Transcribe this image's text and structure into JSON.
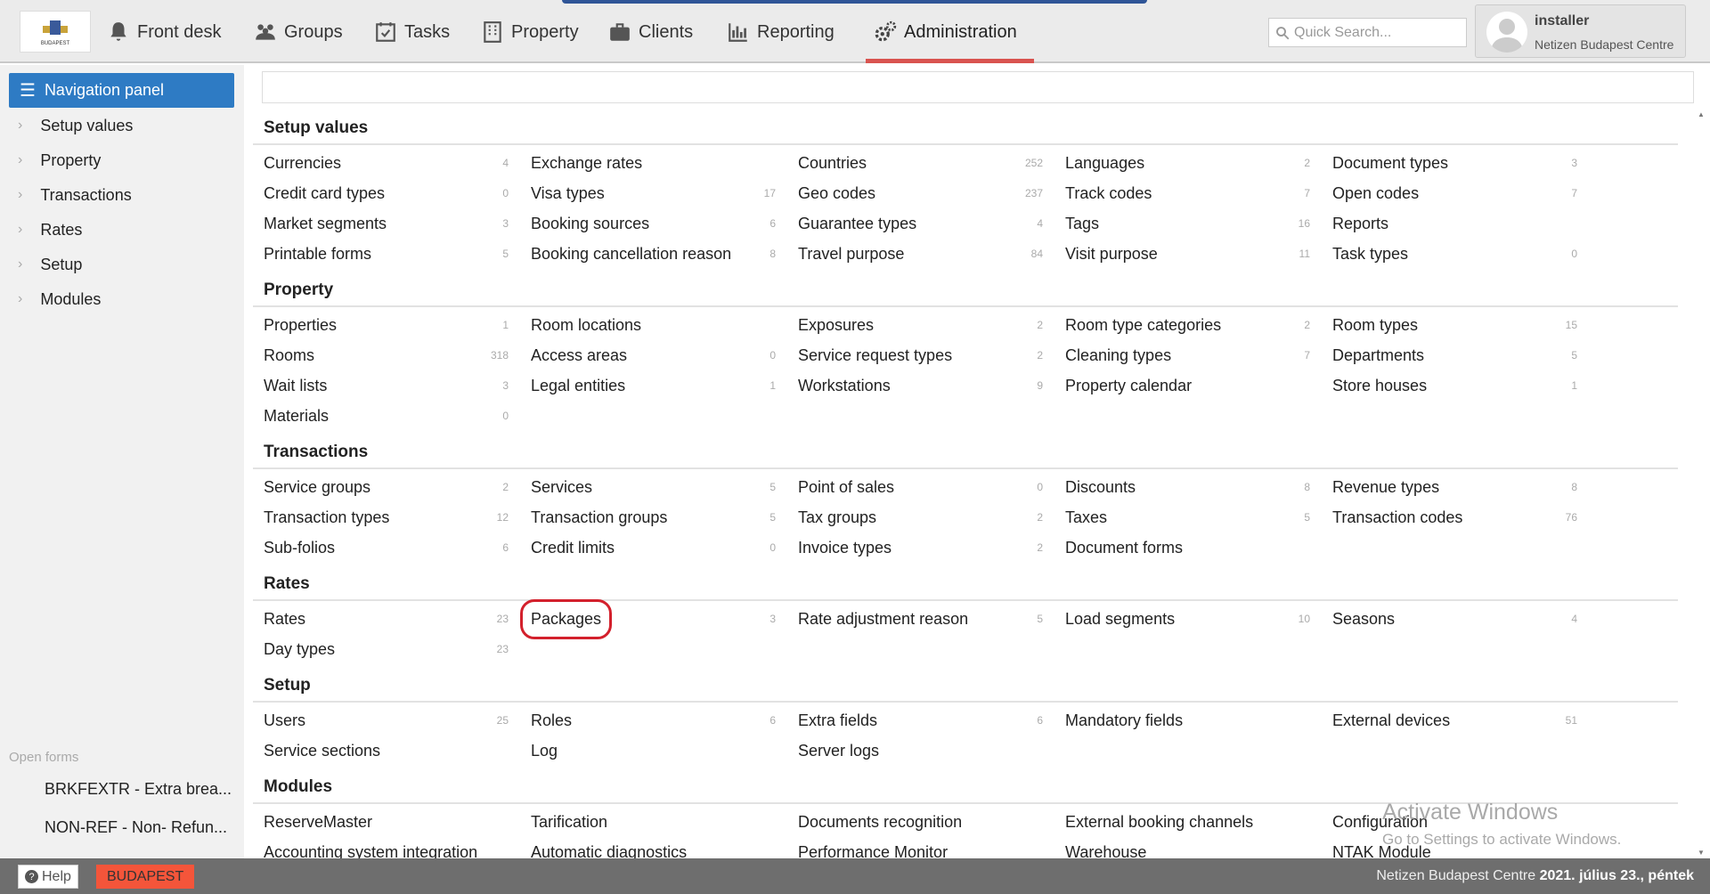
{
  "nav": {
    "tabs": [
      {
        "label": "Front desk",
        "icon": "bell-icon"
      },
      {
        "label": "Groups",
        "icon": "users-icon"
      },
      {
        "label": "Tasks",
        "icon": "calendar-check-icon"
      },
      {
        "label": "Property",
        "icon": "building-icon"
      },
      {
        "label": "Clients",
        "icon": "briefcase-icon"
      },
      {
        "label": "Reporting",
        "icon": "bar-chart-icon"
      },
      {
        "label": "Administration",
        "icon": "gears-icon",
        "active": true
      }
    ],
    "search_placeholder": "Quick Search...",
    "user": {
      "name": "installer",
      "property": "Netizen Budapest Centre"
    },
    "logo_text": "BUDAPEST"
  },
  "sidebar": {
    "title": "Navigation panel",
    "items": [
      "Setup values",
      "Property",
      "Transactions",
      "Rates",
      "Setup",
      "Modules"
    ],
    "open_forms_label": "Open forms",
    "open_forms": [
      "BRKFEXTR - Extra brea...",
      "NON-REF - Non- Refun..."
    ]
  },
  "sections": [
    {
      "title": "Setup values",
      "items": [
        [
          "Currencies",
          "4"
        ],
        [
          "Exchange rates",
          ""
        ],
        [
          "Countries",
          "252"
        ],
        [
          "Languages",
          "2"
        ],
        [
          "Document types",
          "3"
        ],
        [
          "Credit card types",
          "0"
        ],
        [
          "Visa types",
          "17"
        ],
        [
          "Geo codes",
          "237"
        ],
        [
          "Track codes",
          "7"
        ],
        [
          "Open codes",
          "7"
        ],
        [
          "Market segments",
          "3"
        ],
        [
          "Booking sources",
          "6"
        ],
        [
          "Guarantee types",
          "4"
        ],
        [
          "Tags",
          "16"
        ],
        [
          "Reports",
          ""
        ],
        [
          "Printable forms",
          "5"
        ],
        [
          "Booking cancellation reason",
          "8"
        ],
        [
          "Travel purpose",
          "84"
        ],
        [
          "Visit purpose",
          "11"
        ],
        [
          "Task types",
          "0"
        ]
      ]
    },
    {
      "title": "Property",
      "items": [
        [
          "Properties",
          "1"
        ],
        [
          "Room locations",
          ""
        ],
        [
          "Exposures",
          "2"
        ],
        [
          "Room type categories",
          "2"
        ],
        [
          "Room types",
          "15"
        ],
        [
          "Rooms",
          "318"
        ],
        [
          "Access areas",
          "0"
        ],
        [
          "Service request types",
          "2"
        ],
        [
          "Cleaning types",
          "7"
        ],
        [
          "Departments",
          "5"
        ],
        [
          "Wait lists",
          "3"
        ],
        [
          "Legal entities",
          "1"
        ],
        [
          "Workstations",
          "9"
        ],
        [
          "Property calendar",
          ""
        ],
        [
          "Store houses",
          "1"
        ],
        [
          "Materials",
          "0"
        ]
      ]
    },
    {
      "title": "Transactions",
      "items": [
        [
          "Service groups",
          "2"
        ],
        [
          "Services",
          "5"
        ],
        [
          "Point of sales",
          "0"
        ],
        [
          "Discounts",
          "8"
        ],
        [
          "Revenue types",
          "8"
        ],
        [
          "Transaction types",
          "12"
        ],
        [
          "Transaction groups",
          "5"
        ],
        [
          "Tax groups",
          "2"
        ],
        [
          "Taxes",
          "5"
        ],
        [
          "Transaction codes",
          "76"
        ],
        [
          "Sub-folios",
          "6"
        ],
        [
          "Credit limits",
          "0"
        ],
        [
          "Invoice types",
          "2"
        ],
        [
          "Document forms",
          ""
        ]
      ]
    },
    {
      "title": "Rates",
      "items": [
        [
          "Rates",
          "23"
        ],
        [
          "Packages",
          "3",
          true
        ],
        [
          "Rate adjustment reason",
          "5"
        ],
        [
          "Load segments",
          "10"
        ],
        [
          "Seasons",
          "4"
        ],
        [
          "Day types",
          "23"
        ]
      ]
    },
    {
      "title": "Setup",
      "items": [
        [
          "Users",
          "25"
        ],
        [
          "Roles",
          "6"
        ],
        [
          "Extra fields",
          "6"
        ],
        [
          "Mandatory fields",
          ""
        ],
        [
          "External devices",
          "51"
        ],
        [
          "Service sections",
          ""
        ],
        [
          "Log",
          ""
        ],
        [
          "Server logs",
          ""
        ]
      ]
    },
    {
      "title": "Modules",
      "items": [
        [
          "ReserveMaster",
          ""
        ],
        [
          "Tarification",
          ""
        ],
        [
          "Documents recognition",
          ""
        ],
        [
          "External booking channels",
          ""
        ],
        [
          "Configuration",
          ""
        ],
        [
          "Accounting system integration",
          ""
        ],
        [
          "Automatic diagnostics",
          ""
        ],
        [
          "Performance Monitor",
          ""
        ],
        [
          "Warehouse",
          ""
        ],
        [
          "NTAK Module",
          ""
        ]
      ]
    }
  ],
  "footer": {
    "help": "Help",
    "site": "BUDAPEST",
    "property": "Netizen Budapest Centre",
    "date": "2021. július 23., péntek"
  },
  "watermark": {
    "line1": "Activate Windows",
    "line2": "Go to Settings to activate Windows."
  },
  "colors": {
    "accent": "#2e7bc4",
    "active_tab": "#d9534f",
    "site_badge": "#f4553a",
    "highlight": "#d3202c"
  }
}
